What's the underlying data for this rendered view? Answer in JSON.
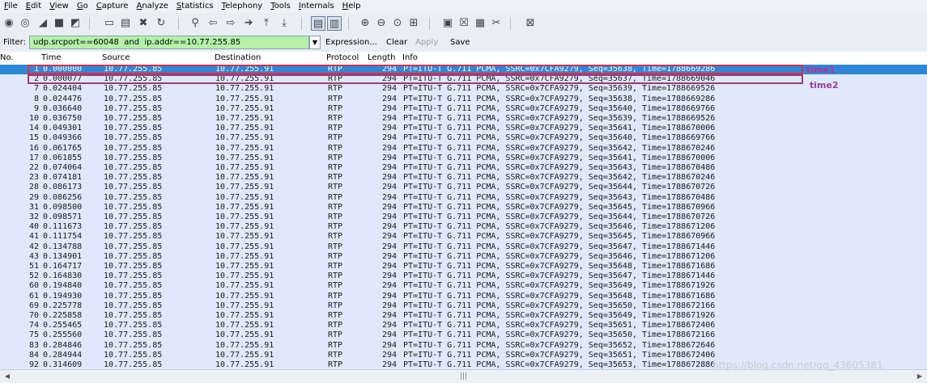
{
  "menu": [
    "File",
    "Edit",
    "View",
    "Go",
    "Capture",
    "Analyze",
    "Statistics",
    "Telephony",
    "Tools",
    "Internals",
    "Help"
  ],
  "toolbar_icons": [
    {
      "name": "interface-list-icon",
      "glyph": "◉"
    },
    {
      "name": "capture-options-icon",
      "glyph": "◎"
    },
    {
      "name": "start-capture-icon",
      "glyph": "◢"
    },
    {
      "name": "stop-capture-icon",
      "glyph": "■"
    },
    {
      "name": "restart-capture-icon",
      "glyph": "◩"
    },
    {
      "name": "open-file-icon",
      "glyph": "▭"
    },
    {
      "name": "save-file-icon",
      "glyph": "▤"
    },
    {
      "name": "close-file-icon",
      "glyph": "✖"
    },
    {
      "name": "reload-icon",
      "glyph": "↻"
    },
    {
      "name": "find-packet-icon",
      "glyph": "⚲"
    },
    {
      "name": "go-back-icon",
      "glyph": "⇦"
    },
    {
      "name": "go-forward-icon",
      "glyph": "⇨"
    },
    {
      "name": "go-to-packet-icon",
      "glyph": "➜"
    },
    {
      "name": "go-first-icon",
      "glyph": "⤒"
    },
    {
      "name": "go-last-icon",
      "glyph": "⤓"
    },
    {
      "name": "colorize-icon",
      "glyph": "▤"
    },
    {
      "name": "autoscroll-icon",
      "glyph": "▥"
    },
    {
      "name": "zoom-in-icon",
      "glyph": "⊕"
    },
    {
      "name": "zoom-out-icon",
      "glyph": "⊖"
    },
    {
      "name": "zoom-normal-icon",
      "glyph": "⊙"
    },
    {
      "name": "resize-columns-icon",
      "glyph": "⊞"
    },
    {
      "name": "capture-filters-icon",
      "glyph": "▣"
    },
    {
      "name": "display-filters-icon",
      "glyph": "☒"
    },
    {
      "name": "coloring-rules-icon",
      "glyph": "▦"
    },
    {
      "name": "preferences-icon",
      "glyph": "✂"
    },
    {
      "name": "help-icon",
      "glyph": "⊠"
    }
  ],
  "filter": {
    "label": "Filter:",
    "value": "udp.srcport==60048  and  ip.addr==10.77.255.85",
    "expression_label": "Expression...",
    "clear_label": "Clear",
    "apply_label": "Apply",
    "save_label": "Save"
  },
  "columns": [
    "No.",
    "Time",
    "Source",
    "Destination",
    "Protocol",
    "Length",
    "Info"
  ],
  "packets": [
    {
      "no": "1",
      "time": "0.000000",
      "source": "10.77.255.85",
      "destination": "10.77.255.91",
      "protocol": "RTP",
      "length": "294",
      "info": "PT=ITU-T G.711 PCMA, SSRC=0x7CFA9279, Seq=35638, Time=1788669286",
      "selected": true
    },
    {
      "no": "2",
      "time": "0.000077",
      "source": "10.77.255.85",
      "destination": "10.77.255.91",
      "protocol": "RTP",
      "length": "294",
      "info": "PT=ITU-T G.711 PCMA, SSRC=0x7CFA9279, Seq=35637, Time=1788669046"
    },
    {
      "no": "7",
      "time": "0.024404",
      "source": "10.77.255.85",
      "destination": "10.77.255.91",
      "protocol": "RTP",
      "length": "294",
      "info": "PT=ITU-T G.711 PCMA, SSRC=0x7CFA9279, Seq=35639, Time=1788669526"
    },
    {
      "no": "8",
      "time": "0.024476",
      "source": "10.77.255.85",
      "destination": "10.77.255.91",
      "protocol": "RTP",
      "length": "294",
      "info": "PT=ITU-T G.711 PCMA, SSRC=0x7CFA9279, Seq=35638, Time=1788669286"
    },
    {
      "no": "9",
      "time": "0.036640",
      "source": "10.77.255.85",
      "destination": "10.77.255.91",
      "protocol": "RTP",
      "length": "294",
      "info": "PT=ITU-T G.711 PCMA, SSRC=0x7CFA9279, Seq=35640, Time=1788669766"
    },
    {
      "no": "10",
      "time": "0.036750",
      "source": "10.77.255.85",
      "destination": "10.77.255.91",
      "protocol": "RTP",
      "length": "294",
      "info": "PT=ITU-T G.711 PCMA, SSRC=0x7CFA9279, Seq=35639, Time=1788669526"
    },
    {
      "no": "14",
      "time": "0.049301",
      "source": "10.77.255.85",
      "destination": "10.77.255.91",
      "protocol": "RTP",
      "length": "294",
      "info": "PT=ITU-T G.711 PCMA, SSRC=0x7CFA9279, Seq=35641, Time=1788670006"
    },
    {
      "no": "15",
      "time": "0.049366",
      "source": "10.77.255.85",
      "destination": "10.77.255.91",
      "protocol": "RTP",
      "length": "294",
      "info": "PT=ITU-T G.711 PCMA, SSRC=0x7CFA9279, Seq=35640, Time=1788669766"
    },
    {
      "no": "16",
      "time": "0.061765",
      "source": "10.77.255.85",
      "destination": "10.77.255.91",
      "protocol": "RTP",
      "length": "294",
      "info": "PT=ITU-T G.711 PCMA, SSRC=0x7CFA9279, Seq=35642, Time=1788670246"
    },
    {
      "no": "17",
      "time": "0.061855",
      "source": "10.77.255.85",
      "destination": "10.77.255.91",
      "protocol": "RTP",
      "length": "294",
      "info": "PT=ITU-T G.711 PCMA, SSRC=0x7CFA9279, Seq=35641, Time=1788670006"
    },
    {
      "no": "22",
      "time": "0.074064",
      "source": "10.77.255.85",
      "destination": "10.77.255.91",
      "protocol": "RTP",
      "length": "294",
      "info": "PT=ITU-T G.711 PCMA, SSRC=0x7CFA9279, Seq=35643, Time=1788670486"
    },
    {
      "no": "23",
      "time": "0.074181",
      "source": "10.77.255.85",
      "destination": "10.77.255.91",
      "protocol": "RTP",
      "length": "294",
      "info": "PT=ITU-T G.711 PCMA, SSRC=0x7CFA9279, Seq=35642, Time=1788670246"
    },
    {
      "no": "28",
      "time": "0.086173",
      "source": "10.77.255.85",
      "destination": "10.77.255.91",
      "protocol": "RTP",
      "length": "294",
      "info": "PT=ITU-T G.711 PCMA, SSRC=0x7CFA9279, Seq=35644, Time=1788670726"
    },
    {
      "no": "29",
      "time": "0.086256",
      "source": "10.77.255.85",
      "destination": "10.77.255.91",
      "protocol": "RTP",
      "length": "294",
      "info": "PT=ITU-T G.711 PCMA, SSRC=0x7CFA9279, Seq=35643, Time=1788670486"
    },
    {
      "no": "31",
      "time": "0.098500",
      "source": "10.77.255.85",
      "destination": "10.77.255.91",
      "protocol": "RTP",
      "length": "294",
      "info": "PT=ITU-T G.711 PCMA, SSRC=0x7CFA9279, Seq=35645, Time=1788670966"
    },
    {
      "no": "32",
      "time": "0.098571",
      "source": "10.77.255.85",
      "destination": "10.77.255.91",
      "protocol": "RTP",
      "length": "294",
      "info": "PT=ITU-T G.711 PCMA, SSRC=0x7CFA9279, Seq=35644, Time=1788670726"
    },
    {
      "no": "40",
      "time": "0.111673",
      "source": "10.77.255.85",
      "destination": "10.77.255.91",
      "protocol": "RTP",
      "length": "294",
      "info": "PT=ITU-T G.711 PCMA, SSRC=0x7CFA9279, Seq=35646, Time=1788671206"
    },
    {
      "no": "41",
      "time": "0.111754",
      "source": "10.77.255.85",
      "destination": "10.77.255.91",
      "protocol": "RTP",
      "length": "294",
      "info": "PT=ITU-T G.711 PCMA, SSRC=0x7CFA9279, Seq=35645, Time=1788670966"
    },
    {
      "no": "42",
      "time": "0.134788",
      "source": "10.77.255.85",
      "destination": "10.77.255.91",
      "protocol": "RTP",
      "length": "294",
      "info": "PT=ITU-T G.711 PCMA, SSRC=0x7CFA9279, Seq=35647, Time=1788671446"
    },
    {
      "no": "43",
      "time": "0.134901",
      "source": "10.77.255.85",
      "destination": "10.77.255.91",
      "protocol": "RTP",
      "length": "294",
      "info": "PT=ITU-T G.711 PCMA, SSRC=0x7CFA9279, Seq=35646, Time=1788671206"
    },
    {
      "no": "51",
      "time": "0.164717",
      "source": "10.77.255.85",
      "destination": "10.77.255.91",
      "protocol": "RTP",
      "length": "294",
      "info": "PT=ITU-T G.711 PCMA, SSRC=0x7CFA9279, Seq=35648, Time=1788671686"
    },
    {
      "no": "52",
      "time": "0.164830",
      "source": "10.77.255.85",
      "destination": "10.77.255.91",
      "protocol": "RTP",
      "length": "294",
      "info": "PT=ITU-T G.711 PCMA, SSRC=0x7CFA9279, Seq=35647, Time=1788671446"
    },
    {
      "no": "60",
      "time": "0.194840",
      "source": "10.77.255.85",
      "destination": "10.77.255.91",
      "protocol": "RTP",
      "length": "294",
      "info": "PT=ITU-T G.711 PCMA, SSRC=0x7CFA9279, Seq=35649, Time=1788671926"
    },
    {
      "no": "61",
      "time": "0.194930",
      "source": "10.77.255.85",
      "destination": "10.77.255.91",
      "protocol": "RTP",
      "length": "294",
      "info": "PT=ITU-T G.711 PCMA, SSRC=0x7CFA9279, Seq=35648, Time=1788671686"
    },
    {
      "no": "69",
      "time": "0.225778",
      "source": "10.77.255.85",
      "destination": "10.77.255.91",
      "protocol": "RTP",
      "length": "294",
      "info": "PT=ITU-T G.711 PCMA, SSRC=0x7CFA9279, Seq=35650, Time=1788672166"
    },
    {
      "no": "70",
      "time": "0.225858",
      "source": "10.77.255.85",
      "destination": "10.77.255.91",
      "protocol": "RTP",
      "length": "294",
      "info": "PT=ITU-T G.711 PCMA, SSRC=0x7CFA9279, Seq=35649, Time=1788671926"
    },
    {
      "no": "74",
      "time": "0.255465",
      "source": "10.77.255.85",
      "destination": "10.77.255.91",
      "protocol": "RTP",
      "length": "294",
      "info": "PT=ITU-T G.711 PCMA, SSRC=0x7CFA9279, Seq=35651, Time=1788672406"
    },
    {
      "no": "75",
      "time": "0.255560",
      "source": "10.77.255.85",
      "destination": "10.77.255.91",
      "protocol": "RTP",
      "length": "294",
      "info": "PT=ITU-T G.711 PCMA, SSRC=0x7CFA9279, Seq=35650, Time=1788672166"
    },
    {
      "no": "83",
      "time": "0.284846",
      "source": "10.77.255.85",
      "destination": "10.77.255.91",
      "protocol": "RTP",
      "length": "294",
      "info": "PT=ITU-T G.711 PCMA, SSRC=0x7CFA9279, Seq=35652, Time=1788672646"
    },
    {
      "no": "84",
      "time": "0.284944",
      "source": "10.77.255.85",
      "destination": "10.77.255.91",
      "protocol": "RTP",
      "length": "294",
      "info": "PT=ITU-T G.711 PCMA, SSRC=0x7CFA9279, Seq=35651, Time=1788672406"
    },
    {
      "no": "92",
      "time": "0.314609",
      "source": "10.77.255.85",
      "destination": "10.77.255.91",
      "protocol": "RTP",
      "length": "294",
      "info": "PT=ITU-T G.711 PCMA, SSRC=0x7CFA9279, Seq=35653, Time=1788672886"
    }
  ],
  "annotations": {
    "label1": "time1",
    "label2": "time2"
  },
  "watermark": "https://blog.csdn.net/qq_43605381",
  "colors": {
    "row_bg": "#dfe9fb",
    "selected_bg": "#2f87d8",
    "filter_bg": "#b4f2a8",
    "annotation_red": "#d9314a",
    "annotation_purple": "#9b3a7c"
  }
}
